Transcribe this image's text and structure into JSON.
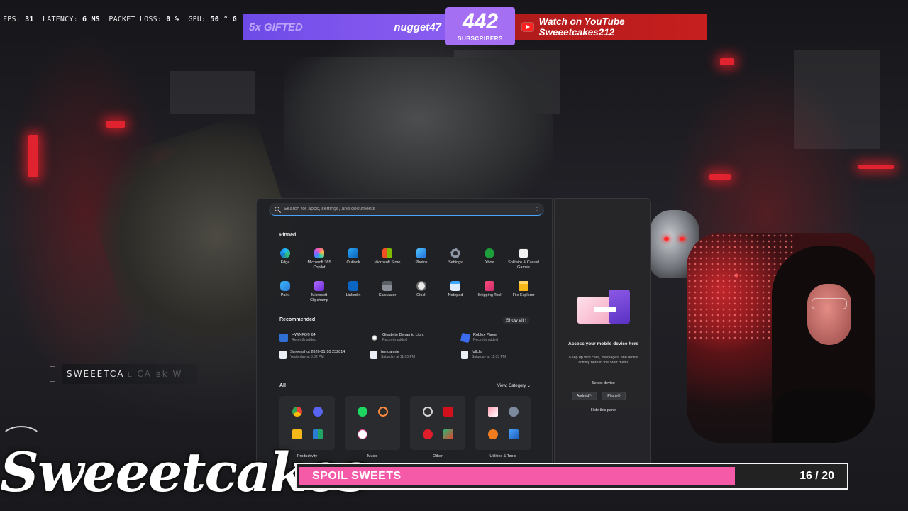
{
  "perf": {
    "fps_label": "FPS:",
    "fps_value": "31",
    "latency_label": "LATENCY:",
    "latency_value": "6 MS",
    "loss_label": "PACKET LOSS:",
    "loss_value": "0 %",
    "gpu_label": "GPU:",
    "gpu_value": "50 ° G"
  },
  "alerts": {
    "gift_text": "5x GIFTED",
    "gifter_name": "nugget47",
    "subscriber_count": "442",
    "subscriber_label": "SUBSCRIBERS",
    "youtube_text": "Watch on YouTube Sweeetcakes212",
    "accent_purple": "#7b52ec",
    "accent_red": "#c71f1f"
  },
  "start_menu": {
    "search_placeholder": "Search for apps, settings, and documents",
    "pinned_title": "Pinned",
    "pinned": [
      {
        "label": "Edge",
        "icon": "edge-icon"
      },
      {
        "label": "Microsoft 365 Copilot",
        "icon": "m365-copilot-icon"
      },
      {
        "label": "Outlook",
        "icon": "outlook-icon"
      },
      {
        "label": "Microsoft Store",
        "icon": "store-icon"
      },
      {
        "label": "Photos",
        "icon": "photos-icon"
      },
      {
        "label": "Settings",
        "icon": "settings-icon"
      },
      {
        "label": "Xbox",
        "icon": "xbox-icon"
      },
      {
        "label": "Solitaire & Casual Games",
        "icon": "solitaire-icon"
      },
      {
        "label": "Paint",
        "icon": "paint-icon"
      },
      {
        "label": "Microsoft Clipchamp",
        "icon": "clipchamp-icon"
      },
      {
        "label": "LinkedIn",
        "icon": "linkedin-icon"
      },
      {
        "label": "Calculator",
        "icon": "calculator-icon"
      },
      {
        "label": "Clock",
        "icon": "clock-icon"
      },
      {
        "label": "Notepad",
        "icon": "notepad-icon"
      },
      {
        "label": "Snipping Tool",
        "icon": "snipping-tool-icon"
      },
      {
        "label": "File Explorer",
        "icon": "file-explorer-icon"
      }
    ],
    "recommended_title": "Recommended",
    "show_all": "Show all  ›",
    "recommended": [
      {
        "name": "HWiNFO® 64",
        "sub": "Recently added",
        "icon": "hwinfo-icon"
      },
      {
        "name": "Gigabyte Dynamic Light",
        "sub": "Recently added",
        "icon": "gigabyte-light-icon"
      },
      {
        "name": "Roblox Player",
        "sub": "Recently added",
        "icon": "roblox-icon"
      },
      {
        "name": "Screenshot 2026-01-10 232814",
        "sub": "Yesterday at 8:32 PM",
        "icon": "image-file-icon"
      },
      {
        "name": "temuannie",
        "sub": "Saturday at 11:05 PM",
        "icon": "file-icon"
      },
      {
        "name": "fullclip",
        "sub": "Saturday at 11:03 PM",
        "icon": "file-icon"
      }
    ],
    "all_title": "All",
    "view_label": "View: Category  ⌄",
    "categories": [
      {
        "label": "Productivity",
        "icons": [
          "chrome-icon",
          "discord-icon",
          "folder-icon",
          "office-apps-icon"
        ]
      },
      {
        "label": "Music",
        "icons": [
          "spotify-icon",
          "media-player-icon",
          "itunes-icon"
        ]
      },
      {
        "label": "Other",
        "icons": [
          "obs-icon",
          "adobe-icon",
          "roblox-red-icon",
          "misc-app-icon"
        ]
      },
      {
        "label": "Utilities & Tools",
        "icons": [
          "task-manager-icon",
          "gear-tool-icon",
          "orange-app-icon",
          "control-panel-icon"
        ]
      }
    ]
  },
  "side_panel": {
    "title": "Access your mobile device here",
    "description": "Keep up with calls, messages, and recent activity here in the Start menu.",
    "select_device": "Select device",
    "android": "Android™",
    "iphone": "iPhone®",
    "hide_pane": "Hide this pane"
  },
  "player_tag": {
    "name": "SWEEETCA",
    "ghost": "ʟ CA ʙk W"
  },
  "brand": {
    "logo_text": "Sweeetcakes"
  },
  "goal": {
    "label": "SPOIL SWEETS",
    "current": 16,
    "target": 20,
    "count_text": "16 / 20",
    "fill_color": "#f45aa8"
  }
}
